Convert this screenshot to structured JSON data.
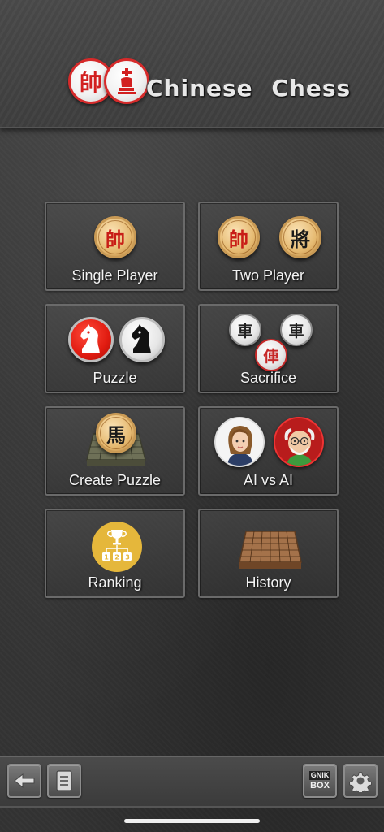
{
  "header": {
    "title": "Chinese  Chess",
    "logo_piece_1": "帥",
    "logo_piece_2": "king-icon"
  },
  "menu": {
    "single_player": {
      "label": "Single Player",
      "piece": "帥"
    },
    "two_player": {
      "label": "Two Player",
      "piece_red": "帥",
      "piece_black": "將"
    },
    "puzzle": {
      "label": "Puzzle",
      "icons": [
        "red-knight-icon",
        "black-knight-icon"
      ]
    },
    "sacrifice": {
      "label": "Sacrifice",
      "piece_a": "車",
      "piece_b": "車",
      "piece_c": "俥"
    },
    "create_puzzle": {
      "label": "Create Puzzle",
      "piece": "馬"
    },
    "ai_vs_ai": {
      "label": "AI vs AI",
      "icons": [
        "girl-avatar",
        "old-man-avatar"
      ]
    },
    "ranking": {
      "label": "Ranking",
      "digits": [
        "1",
        "2",
        "3"
      ]
    },
    "history": {
      "label": "History",
      "icon": "board-icon"
    }
  },
  "bottom_bar": {
    "back_icon": "back-arrow-icon",
    "notes_icon": "notes-icon",
    "brand_line1": "GNIK",
    "brand_line2": "BOX",
    "settings_icon": "gear-icon"
  },
  "colors": {
    "red": "#c81d16",
    "gold": "#e5b73b",
    "tile_border": "#6a6a6a"
  }
}
